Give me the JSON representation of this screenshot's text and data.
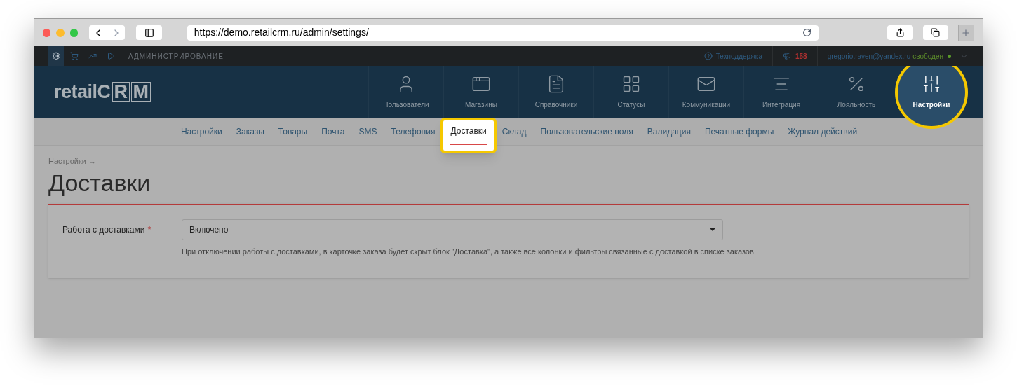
{
  "browser": {
    "url": "https://demo.retailcrm.ru/admin/settings/"
  },
  "top_bar": {
    "modes": [
      {
        "kind": "gear",
        "selected": true
      },
      {
        "kind": "cart",
        "selected": false
      },
      {
        "kind": "chart",
        "selected": false
      },
      {
        "kind": "play",
        "selected": false
      }
    ],
    "section": "АДМИНИСТРИРОВАНИЕ",
    "support": "Техподдержка",
    "notifications": "158",
    "user_email": "gregorio.raven@yandex.ru",
    "user_status": "свободен"
  },
  "logo": {
    "prefix": "retail",
    "letters": [
      "C",
      "R",
      "M"
    ]
  },
  "main_nav": [
    {
      "kind": "users",
      "label": "Пользователи",
      "selected": false
    },
    {
      "kind": "shops",
      "label": "Магазины",
      "selected": false
    },
    {
      "kind": "refs",
      "label": "Справочники",
      "selected": false
    },
    {
      "kind": "statuses",
      "label": "Статусы",
      "selected": false
    },
    {
      "kind": "comms",
      "label": "Коммуникации",
      "selected": false
    },
    {
      "kind": "integration",
      "label": "Интеграция",
      "selected": false
    },
    {
      "kind": "loyalty",
      "label": "Лояльность",
      "selected": false
    },
    {
      "kind": "settings",
      "label": "Настройки",
      "selected": true
    }
  ],
  "sub_nav": [
    {
      "label": "Настройки",
      "selected": false
    },
    {
      "label": "Заказы",
      "selected": false
    },
    {
      "label": "Товары",
      "selected": false
    },
    {
      "label": "Почта",
      "selected": false
    },
    {
      "label": "SMS",
      "selected": false
    },
    {
      "label": "Телефония",
      "selected": false
    },
    {
      "label": "Доставки",
      "selected": true
    },
    {
      "label": "Склад",
      "selected": false
    },
    {
      "label": "Пользовательские поля",
      "selected": false
    },
    {
      "label": "Валидация",
      "selected": false
    },
    {
      "label": "Печатные формы",
      "selected": false
    },
    {
      "label": "Журнал действий",
      "selected": false
    }
  ],
  "breadcrumb": "Настройки →",
  "page_title": "Доставки",
  "form": {
    "label": "Работа с доставками",
    "required_mark": "*",
    "value": "Включено",
    "hint": "При отключении работы с доставками, в карточке заказа будет скрыт блок \"Доставка\", а также все колонки и фильтры связанные с доставкой в списке заказов"
  }
}
